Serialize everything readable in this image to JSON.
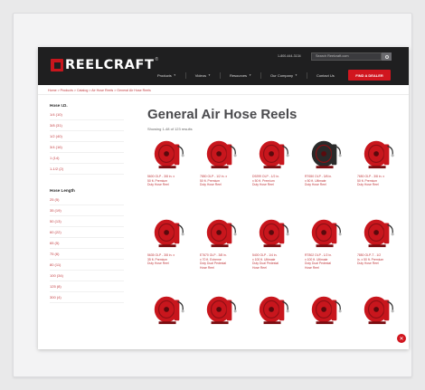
{
  "header": {
    "logo_text": "REELCRAFT",
    "logo_tm": "®",
    "phone": "1-800-444-3134",
    "search_placeholder": "Search Reelcraft.com",
    "nav": [
      "Products",
      "Videos",
      "Resources",
      "Our Company",
      "Contact Us"
    ],
    "dealer_button": "FIND A DEALER"
  },
  "breadcrumb": "Home > Products > Catalog > Air Hose Reels > General Air Hose Reels",
  "sidebar": {
    "hose_id_title": "Hose I.D.",
    "hose_id_items": [
      "1/4 (10)",
      "3/8 (31)",
      "1/2 (40)",
      "3/4 (16)",
      "1 (14)",
      "1-1/2 (2)"
    ],
    "hose_length_title": "Hose Length",
    "hose_length_items": [
      "25 (5)",
      "35 (19)",
      "50 (13)",
      "60 (22)",
      "65 (5)",
      "75 (6)",
      "80 (11)",
      "100 (34)",
      "125 (8)",
      "300 (4)"
    ]
  },
  "main": {
    "title": "General Air Hose Reels",
    "showing": "Showing 1-48 of 123 results"
  },
  "products": [
    {
      "lines": [
        "5600 OLP - 3/8 in. x",
        "50 ft. Premium",
        "Duty Hose Reel"
      ],
      "color": "#c8161d"
    },
    {
      "lines": [
        "7850 OLP - 1/2 in. x",
        "50 ft. Premium",
        "Duty Hose Reel"
      ],
      "color": "#c8161d"
    },
    {
      "lines": [
        "D9299 OLP - 1/2 in.",
        "x 50 ft. Premium",
        "Duty Hose Reel"
      ],
      "color": "#c8161d"
    },
    {
      "lines": [
        "RT650 OLP - 3/8 in.",
        "x 50 ft. Ultimate",
        "Duty Hose Reel"
      ],
      "color": "#2a2a2a"
    },
    {
      "lines": [
        "7650 OLP - 3/8 in. x",
        "50 ft. Premium",
        "Duty Hose Reel"
      ],
      "color": "#c8161d"
    },
    {
      "lines": [
        "5635 OLP - 3/8 in. x",
        "35 ft. Premium",
        "Duty Hose Reel"
      ],
      "color": "#c8161d"
    },
    {
      "lines": [
        "E7670 OLP - 3/8 in.",
        "x 70 ft. Extreme",
        "Duty Dual Pedestal",
        "Hose Reel"
      ],
      "color": "#c8161d"
    },
    {
      "lines": [
        "5400 OLP - 1/4 in.",
        "x 100 ft. Ultimate",
        "Duty Dual Pedestal",
        "Hose Reel"
      ],
      "color": "#c8161d"
    },
    {
      "lines": [
        "RT802 OLP - 1/2 in.",
        "x 100 ft. Ultimate",
        "Duty Dual Pedestal",
        "Hose Reel"
      ],
      "color": "#c8161d"
    },
    {
      "lines": [
        "7850 OLP-T - 1/2",
        "in. x 50 ft. Premium",
        "Duty Hose Reel"
      ],
      "color": "#c8161d"
    },
    {
      "lines": [],
      "color": "#c8161d"
    },
    {
      "lines": [],
      "color": "#c8161d"
    },
    {
      "lines": [],
      "color": "#c8161d"
    },
    {
      "lines": [],
      "color": "#c8161d"
    },
    {
      "lines": [],
      "color": "#c8161d"
    }
  ],
  "chat_icon": "chat-icon"
}
